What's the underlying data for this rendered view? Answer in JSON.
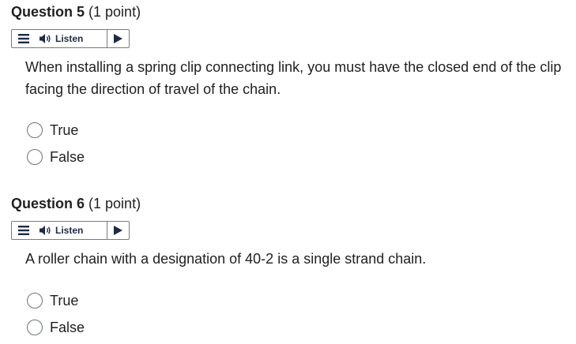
{
  "questions": [
    {
      "title": "Question 5",
      "points": "(1 point)",
      "listen_label": "Listen",
      "text": "When installing a spring clip connecting link, you must have the closed end of the clip facing the direction of travel of the chain.",
      "options": [
        "True",
        "False"
      ]
    },
    {
      "title": "Question 6",
      "points": "(1 point)",
      "listen_label": "Listen",
      "text": "A roller chain with a designation of 40-2 is a single strand chain.",
      "options": [
        "True",
        "False"
      ]
    }
  ],
  "icons": {
    "menu": "menu-icon",
    "speaker": "speaker-icon",
    "play": "play-icon"
  },
  "colors": {
    "text": "#202122",
    "listen_text": "#1f2a44",
    "border": "#7a7a7a"
  }
}
